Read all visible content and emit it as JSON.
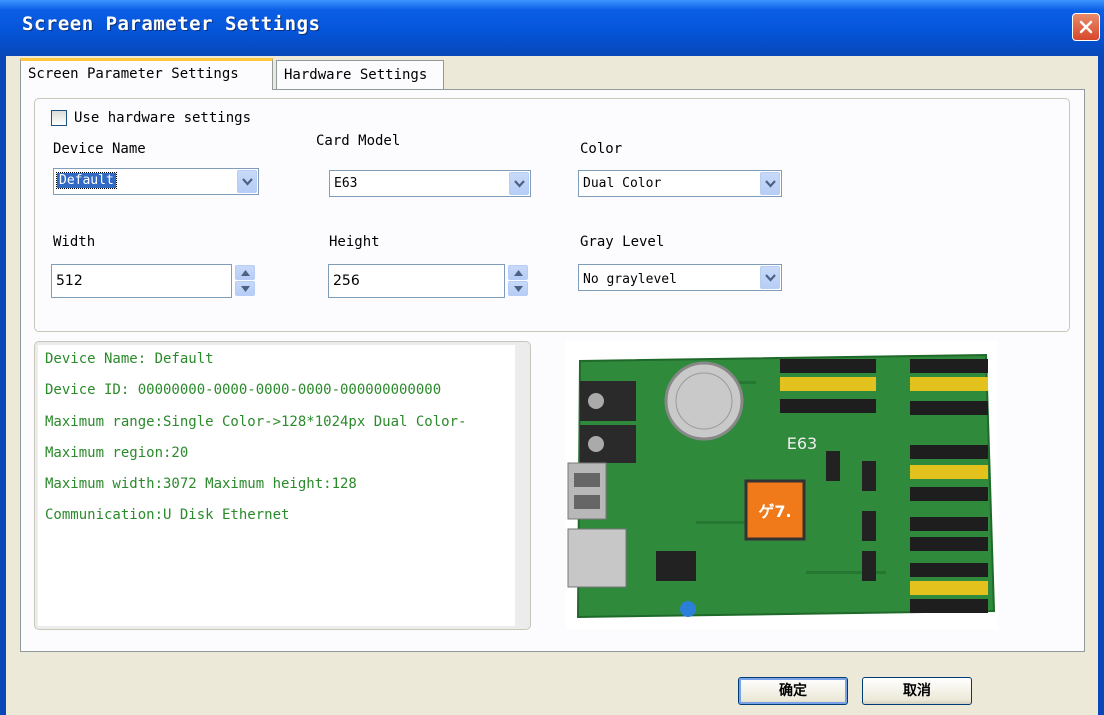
{
  "window": {
    "title": "Screen Parameter Settings",
    "close_icon": "close-icon"
  },
  "tabs": [
    {
      "label": "Screen Parameter Settings",
      "active": true
    },
    {
      "label": "Hardware Settings",
      "active": false
    }
  ],
  "form": {
    "use_hardware_label": "Use hardware settings",
    "use_hardware_checked": false,
    "device_name_label": "Device Name",
    "device_name_value": "Default",
    "card_model_label": "Card Model",
    "card_model_value": "E63",
    "color_label": "Color",
    "color_value": "Dual Color",
    "width_label": "Width",
    "width_value": "512",
    "height_label": "Height",
    "height_value": "256",
    "gray_level_label": "Gray Level",
    "gray_level_value": "No graylevel"
  },
  "info": {
    "lines": [
      "Device Name: Default",
      "Device ID:  00000000-0000-0000-0000-000000000000",
      "Maximum range:Single Color->128*1024px  Dual Color-",
      "Maximum region:20",
      "Maximum width:3072 Maximum height:128",
      "Communication:U Disk  Ethernet"
    ],
    "color": "#2b8a2b"
  },
  "board": {
    "model_label": "E63",
    "chip_label": "ゲ7."
  },
  "buttons": {
    "ok_label": "确定",
    "cancel_label": "取消"
  },
  "colors": {
    "titlebar": "#0553d6",
    "accent_tab": "#ffc83c",
    "selection": "#316ac5"
  }
}
